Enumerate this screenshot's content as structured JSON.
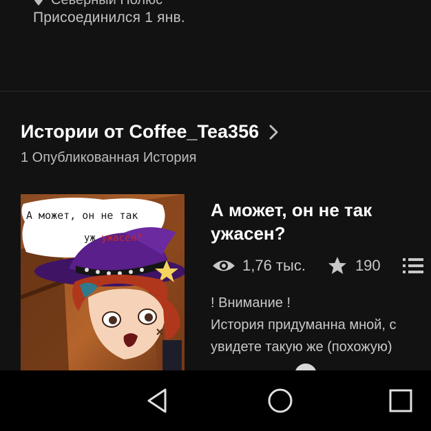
{
  "profile": {
    "location": "Северный Полюс",
    "joined": "Присоединился 1 янв."
  },
  "section": {
    "title": "Истории от Coffee_Tea356",
    "subtitle": "1 Опубликованная История"
  },
  "story": {
    "title": "А может, он не так ужасен?",
    "cover": {
      "speech_line1": "А может, он не так",
      "speech_line2_a": "уж",
      "speech_line2_b": "ужасен?"
    },
    "stats": {
      "reads": "1,76 тыс.",
      "votes": "190"
    },
    "description_lines": [
      "! Внимание !",
      "История придуманна мной, с",
      "увидете такую же (похожую)"
    ]
  },
  "icons": {
    "location": "location-pin-icon",
    "chevron": "chevron-right-icon",
    "reads": "eye-icon",
    "votes": "star-icon",
    "parts": "list-icon",
    "nav_back": "triangle-back-icon",
    "nav_home": "circle-home-icon",
    "nav_recents": "square-recents-icon"
  },
  "colors": {
    "background": "#121212",
    "navbar": "#000000",
    "text_primary": "#ffffff",
    "text_secondary": "#bdbdbd",
    "cover_hat": "#5a1f8a",
    "cover_accent": "#c62828"
  }
}
